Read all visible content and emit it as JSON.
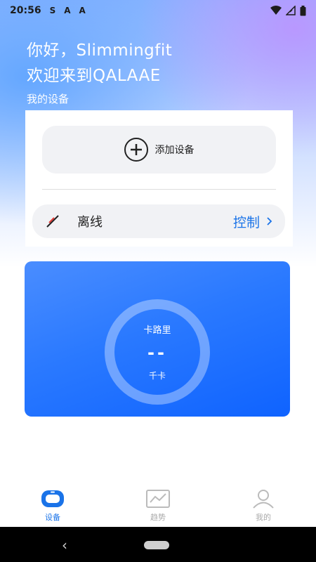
{
  "status_bar": {
    "time": "20:56",
    "left_icons": [
      "S",
      "A",
      "A"
    ],
    "right_icons": [
      "wifi-icon",
      "signal-icon",
      "battery-icon"
    ]
  },
  "greeting": {
    "line1": "你好，Slimmingfit",
    "line2": "欢迎来到QALAAE"
  },
  "devices": {
    "section_title": "我的设备",
    "add_label": "添加设备",
    "status_label": "离线",
    "control_label": "控制"
  },
  "calories": {
    "title": "卡路里",
    "value": "--",
    "unit": "千卡"
  },
  "nav": {
    "items": [
      {
        "label": "设备",
        "active": true
      },
      {
        "label": "趋势",
        "active": false
      },
      {
        "label": "我的",
        "active": false
      }
    ]
  },
  "colors": {
    "accent": "#1a73e8",
    "card_start": "#4a8dff",
    "card_end": "#0f63ff"
  }
}
